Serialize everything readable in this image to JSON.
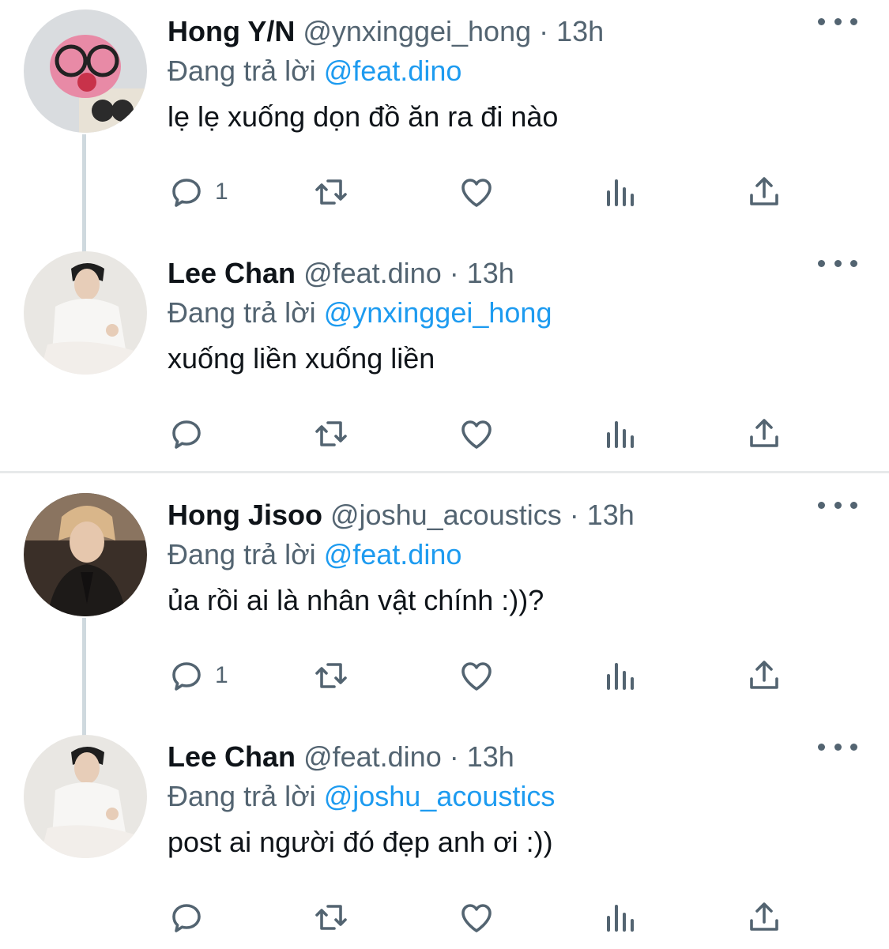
{
  "tweets": [
    {
      "name": "Hong Y/N",
      "handle": "@ynxinggei_hong",
      "time": "· 13h",
      "replying_label": "Đang trả lời",
      "replying_to": "@feat.dino",
      "text": "lẹ lẹ xuống dọn đồ ăn ra đi nào",
      "reply_count": "1",
      "avatar": "pink-plush-with-glasses"
    },
    {
      "name": "Lee Chan",
      "handle": "@feat.dino",
      "time": "· 13h",
      "replying_label": "Đang trả lời",
      "replying_to": "@ynxinggei_hong",
      "text": "xuống liền xuống liền",
      "reply_count": "",
      "avatar": "man-in-white-shirt"
    },
    {
      "name": "Hong Jisoo",
      "handle": "@joshu_acoustics",
      "time": "· 13h",
      "replying_label": "Đang trả lời",
      "replying_to": "@feat.dino",
      "text": "ủa rồi ai là nhân vật chính :))?",
      "reply_count": "1",
      "avatar": "man-blonde-dark-suit"
    },
    {
      "name": "Lee Chan",
      "handle": "@feat.dino",
      "time": "· 13h",
      "replying_label": "Đang trả lời",
      "replying_to": "@joshu_acoustics",
      "text": "post ai người đó đẹp anh ơi :))",
      "reply_count": "",
      "avatar": "man-in-white-shirt"
    }
  ],
  "colors": {
    "text": "#0f1419",
    "secondary": "#536471",
    "link": "#1d9bf0",
    "thread_line": "#cfd9de",
    "divider": "#e7e9ea"
  },
  "icons": [
    "reply-icon",
    "retweet-icon",
    "like-icon",
    "views-icon",
    "share-icon",
    "more-icon"
  ]
}
